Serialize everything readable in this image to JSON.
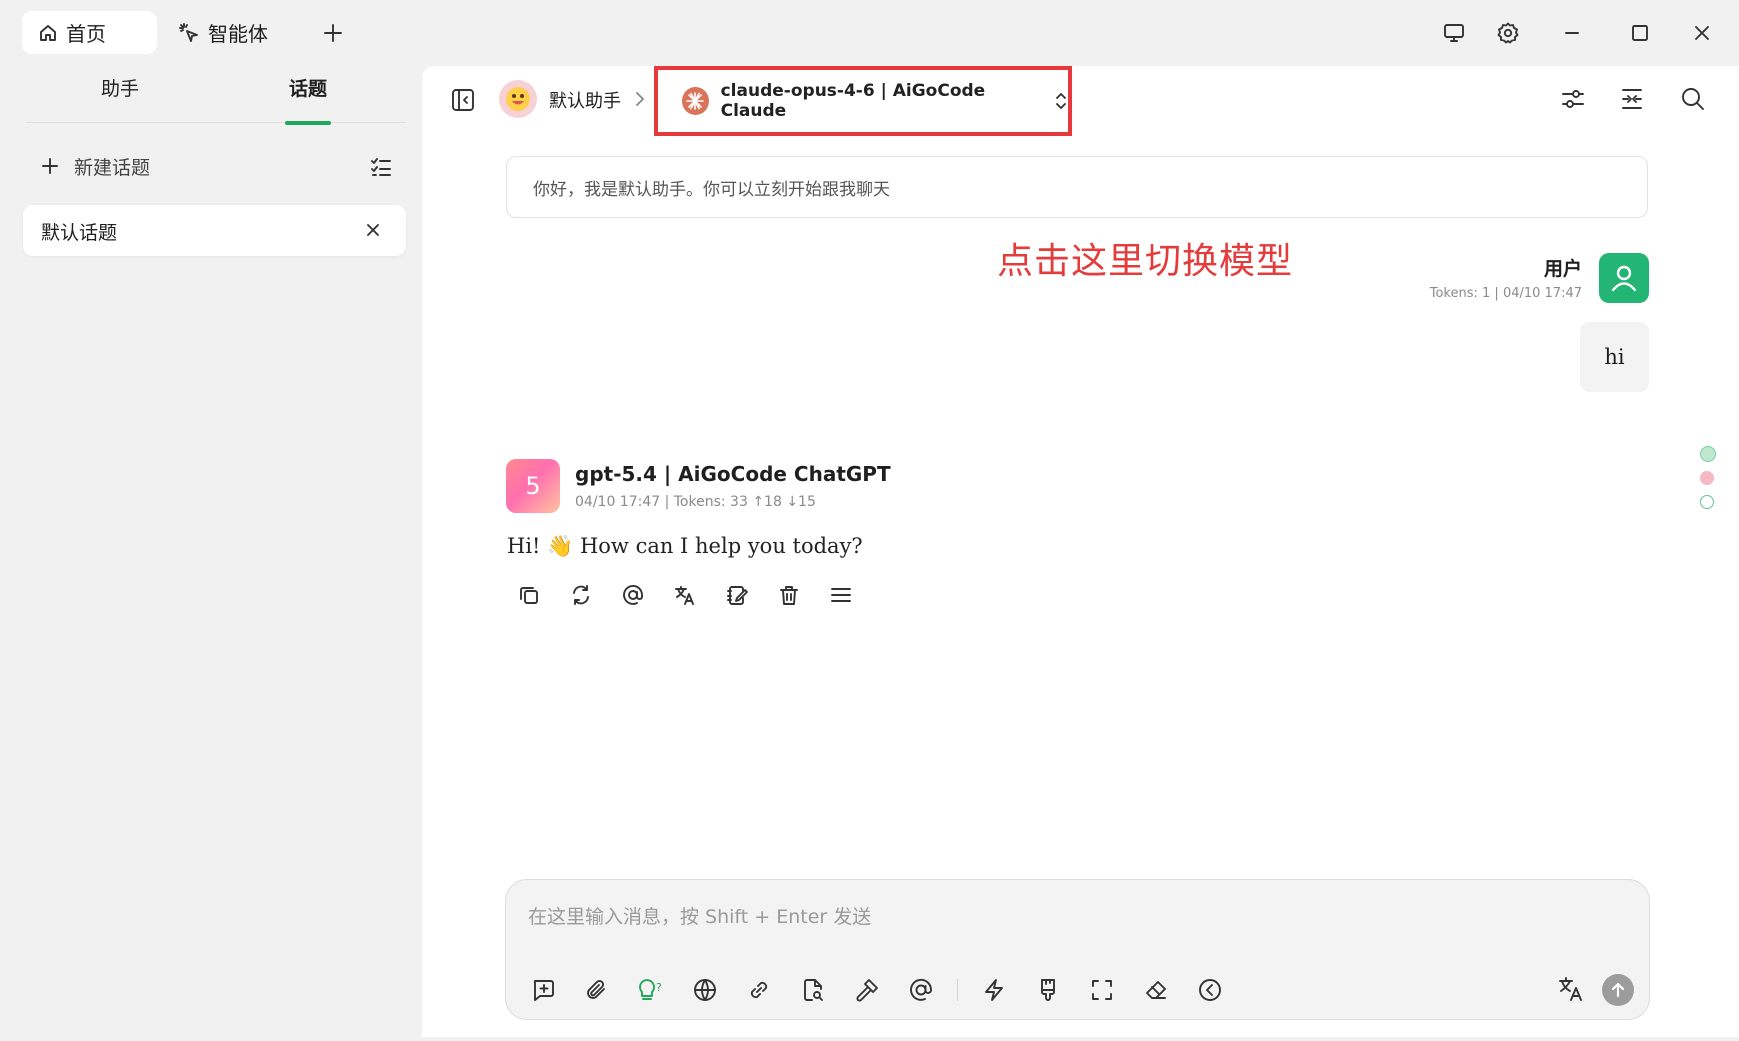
{
  "titlebar": {
    "tabs": [
      {
        "label": "首页",
        "icon": "home-icon"
      },
      {
        "label": "智能体",
        "icon": "sparkle-cursor-icon"
      }
    ],
    "new_tab_icon": "plus-icon",
    "window_buttons": [
      "monitor-icon",
      "gear-icon",
      "minimize-icon",
      "maximize-icon",
      "close-icon"
    ]
  },
  "sidebar": {
    "tabs": [
      {
        "label": "助手",
        "active": false
      },
      {
        "label": "话题",
        "active": true
      }
    ],
    "new_topic_label": "新建话题",
    "topics": [
      {
        "label": "默认话题"
      }
    ]
  },
  "header": {
    "assistant_name": "默认助手",
    "model_label": "claude-opus-4-6 | AiGoCode Claude",
    "right_icons": [
      "sliders-icon",
      "collapse-icon",
      "search-icon"
    ]
  },
  "chat": {
    "greeting": "你好，我是默认助手。你可以立刻开始跟我聊天",
    "annotation": "点击这里切换模型",
    "user": {
      "name": "用户",
      "meta": "Tokens: 1 | 04/10 17:47",
      "message": "hi"
    },
    "bot": {
      "avatar_text": "5",
      "name": "gpt-5.4 | AiGoCode ChatGPT",
      "meta": "04/10 17:47 | Tokens: 33 ↑18 ↓15",
      "message": "Hi! 👋 How can I help you today?"
    },
    "message_actions": [
      "copy-icon",
      "regenerate-icon",
      "mention-icon",
      "translate-icon",
      "edit-icon",
      "delete-icon",
      "menu-icon"
    ]
  },
  "composer": {
    "placeholder": "在这里输入消息，按 Shift + Enter 发送",
    "tools": [
      "new-topic-icon",
      "attachment-icon",
      "lightbulb-icon",
      "globe-icon",
      "link-icon",
      "file-search-icon",
      "hammer-icon",
      "mention-icon",
      "lightning-icon",
      "brush-icon",
      "expand-icon",
      "eraser-icon",
      "chevron-left-circle-icon"
    ],
    "right_tools": [
      "translate-icon",
      "send-icon"
    ]
  },
  "colors": {
    "accent": "#1fa85a",
    "annotation": "#e43b3b",
    "user_avatar": "#22b573"
  }
}
